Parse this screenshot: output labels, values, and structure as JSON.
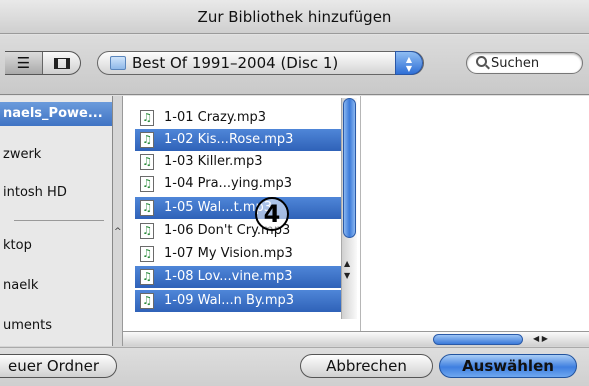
{
  "window": {
    "title": "Zur Bibliothek hinzufügen"
  },
  "toolbar": {
    "view_list_icon": "list-view-icon",
    "view_column_icon": "column-view-icon",
    "location": "Best Of 1991–2004 (Disc 1)",
    "location_stepper": "▲▼",
    "search_placeholder": "Suchen"
  },
  "sidebar": {
    "items": [
      {
        "label": "naels_Powe...",
        "selected": true
      },
      {
        "label": "zwerk",
        "selected": false
      },
      {
        "label": "intosh HD",
        "selected": false
      },
      {
        "label": "ktop",
        "selected": false
      },
      {
        "label": "naelk",
        "selected": false
      },
      {
        "label": "uments",
        "selected": false
      }
    ]
  },
  "files": [
    {
      "name": "1-01 Crazy.mp3",
      "selected": false
    },
    {
      "name": "1-02 Kis...Rose.mp3",
      "selected": true
    },
    {
      "name": "1-03 Killer.mp3",
      "selected": false
    },
    {
      "name": "1-04 Pra...ying.mp3",
      "selected": false
    },
    {
      "name": "1-05 Wal...t.mp3",
      "selected": true
    },
    {
      "name": "1-06 Don't Cry.mp3",
      "selected": false
    },
    {
      "name": "1-07 My Vision.mp3",
      "selected": false
    },
    {
      "name": "1-08 Lov...vine.mp3",
      "selected": true
    },
    {
      "name": "1-09 Wal...n By.mp3",
      "selected": true
    }
  ],
  "file_icon_glyph": "♫",
  "callout": "4",
  "buttons": {
    "new_folder": "euer Ordner",
    "cancel": "Abbrechen",
    "choose": "Auswählen"
  },
  "colors": {
    "accent": "#3f7fe0",
    "selection": "#2f62b8"
  }
}
